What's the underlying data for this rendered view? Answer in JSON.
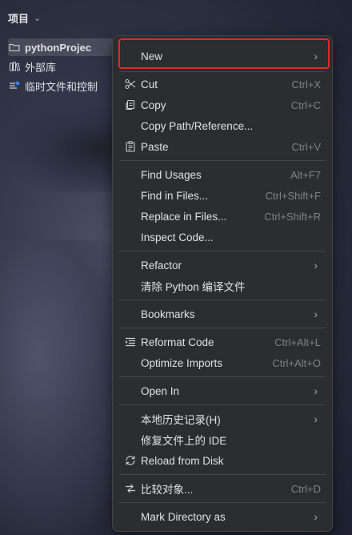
{
  "project_panel": {
    "title": "项目",
    "chevron": "⌄",
    "tree": [
      {
        "label": "pythonProjec",
        "icon": "folder-icon",
        "selected": true
      },
      {
        "label": "外部库",
        "icon": "library-icon",
        "selected": false
      },
      {
        "label": "临时文件和控制",
        "icon": "scratches-icon",
        "selected": false
      }
    ]
  },
  "context_menu": {
    "items": {
      "new": {
        "label": "New",
        "shortcut": "",
        "submenu": true
      },
      "cut": {
        "label": "Cut",
        "shortcut": "Ctrl+X",
        "icon": "scissors-icon"
      },
      "copy": {
        "label": "Copy",
        "shortcut": "Ctrl+C",
        "icon": "copy-icon"
      },
      "copy_path": {
        "label": "Copy Path/Reference...",
        "shortcut": ""
      },
      "paste": {
        "label": "Paste",
        "shortcut": "Ctrl+V",
        "icon": "paste-icon"
      },
      "find_usages": {
        "label": "Find Usages",
        "shortcut": "Alt+F7"
      },
      "find_in_files": {
        "label": "Find in Files...",
        "shortcut": "Ctrl+Shift+F"
      },
      "replace_in_files": {
        "label": "Replace in Files...",
        "shortcut": "Ctrl+Shift+R"
      },
      "inspect_code": {
        "label": "Inspect Code...",
        "shortcut": ""
      },
      "refactor": {
        "label": "Refactor",
        "shortcut": "",
        "submenu": true
      },
      "clean_python": {
        "label": "清除 Python 编译文件",
        "shortcut": ""
      },
      "bookmarks": {
        "label": "Bookmarks",
        "shortcut": "",
        "submenu": true
      },
      "reformat": {
        "label": "Reformat Code",
        "shortcut": "Ctrl+Alt+L",
        "icon": "reformat-icon"
      },
      "optimize_imports": {
        "label": "Optimize Imports",
        "shortcut": "Ctrl+Alt+O"
      },
      "open_in": {
        "label": "Open In",
        "shortcut": "",
        "submenu": true
      },
      "local_history": {
        "label": "本地历史记录(H)",
        "shortcut": "",
        "submenu": true
      },
      "repair_ide": {
        "label": "修复文件上的 IDE",
        "shortcut": ""
      },
      "reload_disk": {
        "label": "Reload from Disk",
        "shortcut": "",
        "icon": "reload-icon"
      },
      "compare": {
        "label": "比较对象...",
        "shortcut": "Ctrl+D",
        "icon": "compare-icon"
      },
      "mark_directory": {
        "label": "Mark Directory as",
        "shortcut": "",
        "submenu": true
      }
    },
    "submenu_arrow": "›",
    "highlighted_item": "New",
    "highlight_color": "#e5262a"
  }
}
